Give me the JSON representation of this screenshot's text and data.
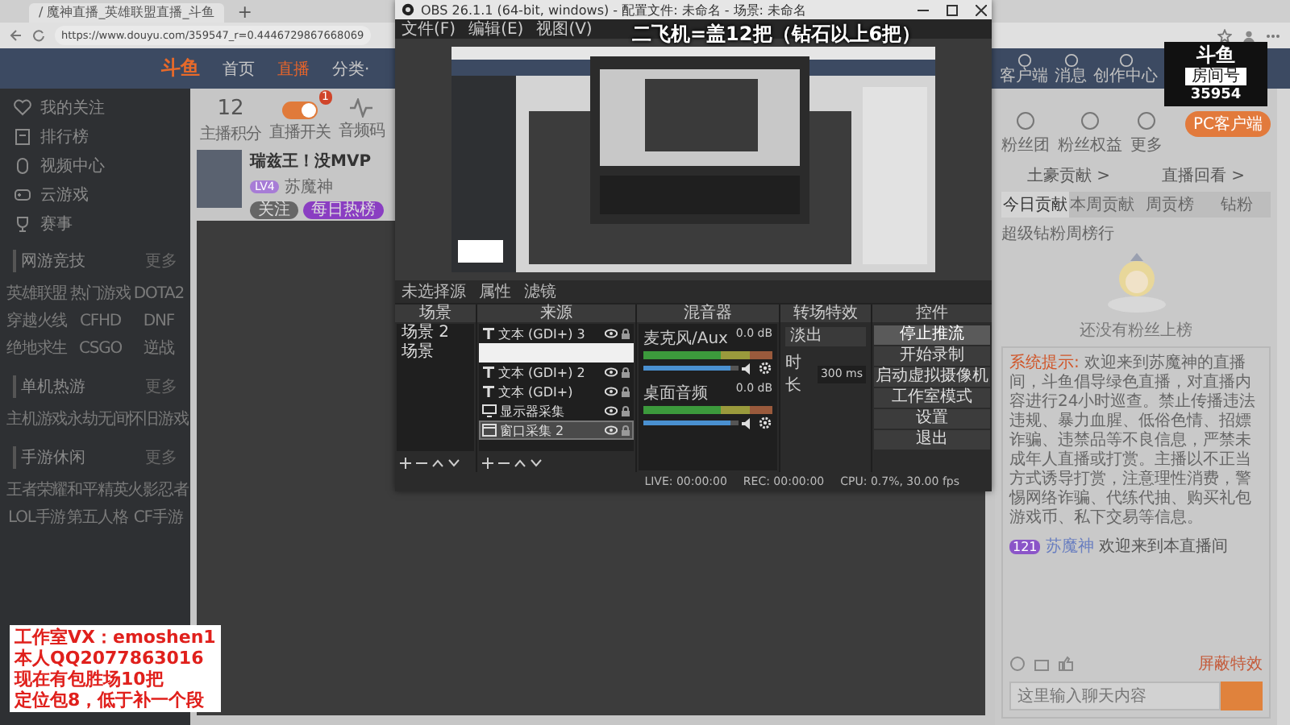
{
  "browser": {
    "tab_title": "/ 魔神直播_英雄联盟直播_斗鱼",
    "new_tab": "+",
    "address": "https://www.douyu.com/359547_r=0.4446729867668069"
  },
  "site": {
    "logo": "斗鱼",
    "nav": [
      {
        "label": "首页",
        "selected": false
      },
      {
        "label": "直播",
        "selected": true
      },
      {
        "label": "分类·",
        "selected": false
      }
    ],
    "header_tools": [
      "客户端",
      "消息",
      "创作中心"
    ],
    "sidebar": {
      "items": [
        "我的关注",
        "排行榜",
        "视频中心",
        "云游戏",
        "赛事"
      ],
      "sections": [
        {
          "title": "网游竞技",
          "more": "更多",
          "games": [
            "英雄联盟",
            "热门游戏",
            "DOTA2",
            "穿越火线",
            "CFHD",
            "DNF",
            "绝地求生",
            "CSGO",
            "逆战"
          ]
        },
        {
          "title": "单机热游",
          "more": "更多",
          "games": [
            "主机游戏",
            "永劫无间",
            "怀旧游戏"
          ]
        },
        {
          "title": "手游休闲",
          "more": "更多",
          "games": [
            "王者荣耀",
            "和平精英",
            "火影忍者",
            "LOL手游",
            "第五人格",
            "CF手游"
          ]
        }
      ]
    },
    "stats": [
      {
        "kind": "number",
        "value": "12",
        "label": "主播积分"
      },
      {
        "kind": "toggle",
        "label": "直播开关",
        "count": "1",
        "on": true
      },
      {
        "kind": "wave",
        "label": "音频码"
      }
    ],
    "streamer": {
      "title": "瑞兹王！没MVP",
      "level": "LV4",
      "name": "苏魔神",
      "buttons": [
        "关注",
        "每日热榜"
      ]
    },
    "right": {
      "stats": [
        "粉丝团",
        "粉丝权益",
        "更多"
      ],
      "pc_client": "PC客户端",
      "links": [
        "土豪贡献 >",
        "直播回看 >"
      ],
      "tabs": [
        {
          "label": "今日贡献",
          "selected": true
        },
        {
          "label": "本周贡献",
          "selected": false
        },
        {
          "label": "周贡榜",
          "selected": false
        },
        {
          "label": "钻粉",
          "selected": false
        }
      ],
      "rank_note": "超级钻粉周榜行",
      "empty_text": "还没有粉丝上榜",
      "chat": [
        {
          "kind": "system",
          "tag": "系统提示:",
          "text": "欢迎来到苏魔神的直播间，斗鱼倡导绿色直播，对直播内容进行24小时巡查。禁止传播违法违规、暴力血腥、低俗色情、招嫖诈骗、违禁品等不良信息，严禁未成年人直播或打赏。主播以不正当方式诱导打赏，注意理性消费，警惕网络诈骗、代练代抽、购买礼包游戏币、私下交易等信息。"
        },
        {
          "kind": "user",
          "badge": "121",
          "name": "苏魔神",
          "text": "欢迎来到本直播间"
        }
      ],
      "barrage_toggle": "屏蔽特效",
      "input_placeholder": "这里输入聊天内容"
    }
  },
  "obs": {
    "title": "OBS 26.1.1 (64-bit, windows) - 配置文件: 未命名 - 场景: 未命名",
    "menu": [
      "文件(F)",
      "编辑(E)",
      "视图(V)"
    ],
    "no_source": "未选择源",
    "properties": "属性",
    "filters": "滤镜",
    "scenes": {
      "title": "场景",
      "items": [
        {
          "label": "场景 2",
          "selected": false
        },
        {
          "label": "场景",
          "selected": false
        }
      ]
    },
    "sources": {
      "title": "来源",
      "items": [
        {
          "kind": "text",
          "label": "文本 (GDI+) 3",
          "selected": false,
          "hover": false
        },
        {
          "kind": "rename",
          "selected": true,
          "hover": false
        },
        {
          "kind": "text",
          "label": "文本 (GDI+) 2",
          "selected": false,
          "hover": false
        },
        {
          "kind": "text",
          "label": "文本 (GDI+)",
          "selected": false,
          "hover": false
        },
        {
          "kind": "monitor",
          "label": "显示器采集",
          "selected": false,
          "hover": false
        },
        {
          "kind": "window",
          "label": "窗口采集 2",
          "selected": false,
          "hover": true
        }
      ]
    },
    "mixer": {
      "title": "混音器",
      "channels": [
        {
          "name": "麦克风/Aux",
          "reading": "0.0 dB",
          "level": 0.92
        },
        {
          "name": "桌面音频",
          "reading": "0.0 dB",
          "level": 0.92
        }
      ]
    },
    "transitions": {
      "title": "转场特效",
      "effect": "淡出",
      "duration_label": "时长",
      "duration": "300 ms"
    },
    "controls": {
      "title": "控件",
      "buttons": [
        {
          "label": "停止推流",
          "active": true
        },
        {
          "label": "开始录制",
          "active": false
        },
        {
          "label": "启动虚拟摄像机",
          "active": false
        },
        {
          "label": "工作室模式",
          "active": false
        },
        {
          "label": "设置",
          "active": false
        },
        {
          "label": "退出",
          "active": false
        }
      ]
    },
    "status": [
      "LIVE: 00:00:00",
      "REC: 00:00:00",
      "CPU: 0.7%, 30.00 fps"
    ]
  },
  "caption": "二飞机=盖12把（钻石以上6把）",
  "contact": [
    "工作室VX：emoshen1",
    "本人QQ2077863016",
    "现在有包胜场10把",
    "定位包8，低于补一个段"
  ],
  "room_badge": {
    "logo": "斗鱼",
    "label": "房间号",
    "number": "35954"
  }
}
